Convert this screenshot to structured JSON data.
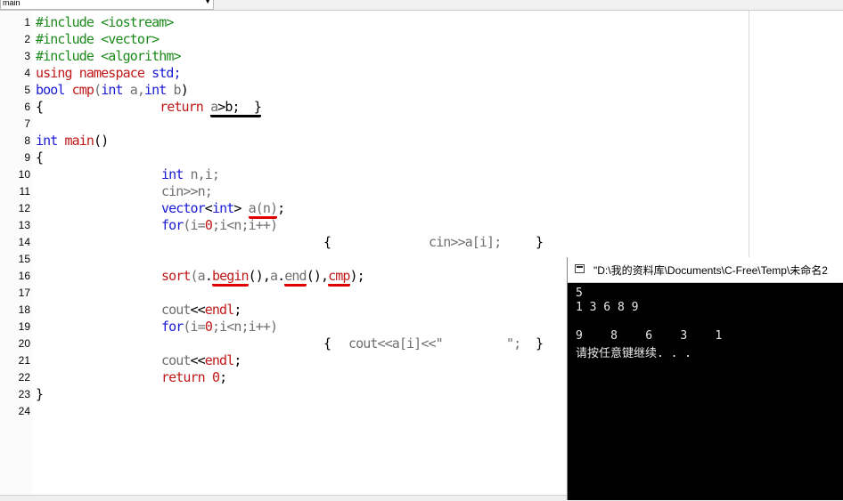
{
  "toolbar": {
    "combo_value": "main"
  },
  "editor": {
    "lines": [
      {
        "n": "1"
      },
      {
        "n": "2"
      },
      {
        "n": "3"
      },
      {
        "n": "4"
      },
      {
        "n": "5"
      },
      {
        "n": "6"
      },
      {
        "n": "7"
      },
      {
        "n": "8"
      },
      {
        "n": "9"
      },
      {
        "n": "10"
      },
      {
        "n": "11"
      },
      {
        "n": "12"
      },
      {
        "n": "13"
      },
      {
        "n": "14"
      },
      {
        "n": "15"
      },
      {
        "n": "16"
      },
      {
        "n": "17"
      },
      {
        "n": "18"
      },
      {
        "n": "19"
      },
      {
        "n": "20"
      },
      {
        "n": "21"
      },
      {
        "n": "22"
      },
      {
        "n": "23"
      },
      {
        "n": "24"
      }
    ],
    "tokens": {
      "l1": "#include <iostream>",
      "l2": "#include <vector>",
      "l3": "#include <algorithm>",
      "l4a": "using",
      "l4b": " namespace",
      "l4c": " std;",
      "l5a": "bool",
      "l5b": " cmp",
      "l5c": "(",
      "l5d": "int",
      "l5e": " a",
      "l5f": ",",
      "l5g": "int",
      "l5h": " b",
      "l5i": ")",
      "l6a": "{",
      "l6b": "return",
      "l6c": "a",
      "l6d": ">b;",
      "l6e": "  }",
      "l8a": "int",
      "l8b": " main",
      "l8c": "()",
      "l9": "{",
      "l10a": "int",
      "l10b": " n,i;",
      "l11a": "cin",
      "l11b": ">>n;",
      "l12a": "vector",
      "l12b": "<",
      "l12c": "int",
      "l12d": ">",
      "l12e": "a",
      "l12f": "(n)",
      "l12g": ";",
      "l13a": "for",
      "l13b": "(i=",
      "l13c": "0",
      "l13d": ";i<n;i++)",
      "l14a": "{",
      "l14b": "cin",
      "l14c": ">>a[i];",
      "l14d": "}",
      "l16a": "sort",
      "l16b": "(",
      "l16c": "a",
      "l16d": ".",
      "l16e": "begin",
      "l16f": "(),",
      "l16g": "a",
      "l16h": ".",
      "l16i": "end",
      "l16j": "(),",
      "l16k": "cmp",
      "l16l": ");",
      "l18a": "cout",
      "l18b": "<<",
      "l18c": "endl",
      "l18d": ";",
      "l19a": "for",
      "l19b": "(i=",
      "l19c": "0",
      "l19d": ";i<n;i++)",
      "l20a": "{",
      "l20b": "cout",
      "l20c": "<<a[i]<<\"",
      "l20d": "\";",
      "l20e": "}",
      "l21a": "cout",
      "l21b": "<<",
      "l21c": "endl",
      "l21d": ";",
      "l22a": "return",
      "l22b": "0",
      "l22c": ";",
      "l23": "}"
    }
  },
  "console": {
    "title": "\"D:\\我的资料库\\Documents\\C-Free\\Temp\\未命名2",
    "lines": [
      "5",
      "1 3 6 8 9",
      "",
      "9    8    6    3    1",
      "请按任意键继续. . ."
    ]
  },
  "colors": {
    "preprocessor": "#1b8a1b",
    "keyword": "#1a1ad6",
    "function": "#c01818",
    "identifier": "#6f6f6f",
    "annotation": "#e00000"
  }
}
